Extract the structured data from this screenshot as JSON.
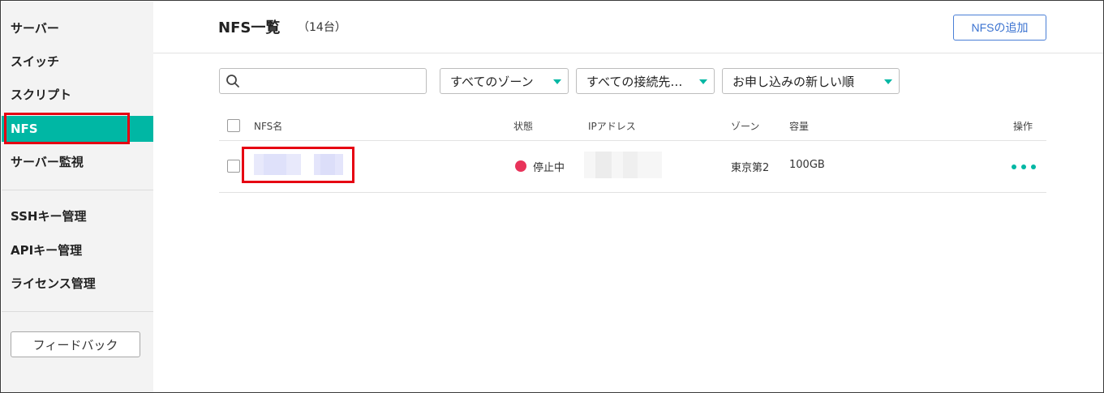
{
  "sidebar": {
    "items": [
      {
        "label": "サーバー"
      },
      {
        "label": "スイッチ"
      },
      {
        "label": "スクリプト"
      },
      {
        "label": "NFS"
      },
      {
        "label": "サーバー監視"
      },
      {
        "label": "SSHキー管理"
      },
      {
        "label": "APIキー管理"
      },
      {
        "label": "ライセンス管理"
      }
    ],
    "active_item": "NFS",
    "feedback_label": "フィードバック"
  },
  "header": {
    "title": "NFS一覧",
    "count": "（14台）",
    "add_button_label": "NFSの追加"
  },
  "filters": {
    "search_placeholder": "",
    "zone_select": "すべてのゾーン",
    "connection_select": "すべての接続先…",
    "sort_select": "お申し込みの新しい順"
  },
  "table": {
    "columns": {
      "name": "NFS名",
      "status": "状態",
      "ip": "IPアドレス",
      "zone": "ゾーン",
      "capacity": "容量",
      "actions": "操作"
    },
    "rows": [
      {
        "name": "",
        "status": "停止中",
        "ip": "",
        "zone": "東京第2",
        "capacity": "100GB"
      }
    ]
  },
  "colors": {
    "accent": "#00b7a4",
    "highlight": "#e60012",
    "status_stopped": "#e8335a",
    "link_blue": "#3a72d0"
  }
}
